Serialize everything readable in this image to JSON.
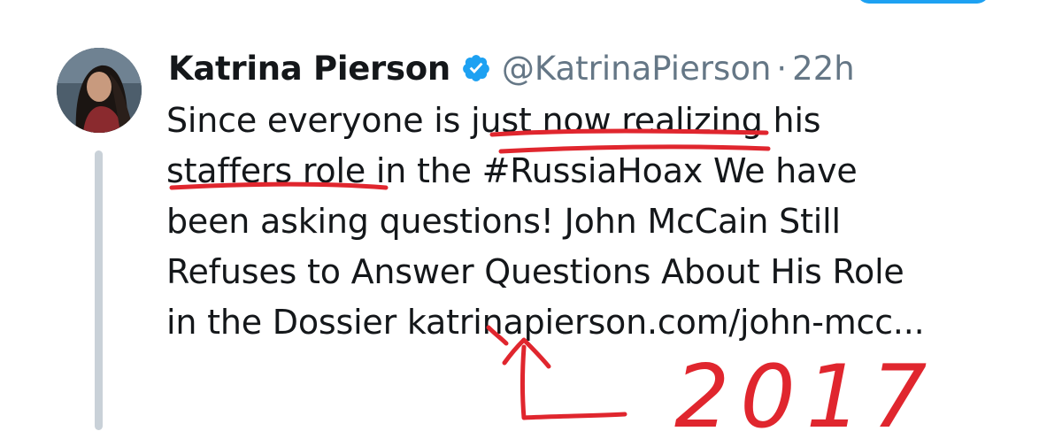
{
  "tweet": {
    "author_name": "Katrina Pierson",
    "handle": "@KatrinaPierson",
    "separator": "·",
    "timestamp": "22h",
    "lines": [
      "Since everyone is just now realizing his",
      "staffers role in the #RussiaHoax We have",
      "been asking questions! John McCain Still",
      "Refuses to Answer Questions About His Role",
      "in the Dossier katrinapierson.com/john-mcc..."
    ]
  },
  "annotation": {
    "handwritten_year": "2017",
    "ink_color": "#e0262e"
  },
  "colors": {
    "brand_blue": "#1da1f2",
    "text_primary": "#14171a",
    "text_secondary": "#657786",
    "thread_line": "#c9d1d8"
  },
  "icons": {
    "verified": "verified-badge-icon",
    "avatar": "profile-photo"
  }
}
